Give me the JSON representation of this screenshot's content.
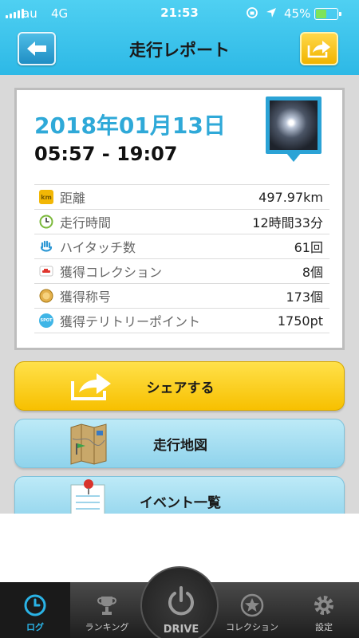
{
  "status_bar": {
    "carrier": "au",
    "network": "4G",
    "time": "21:53",
    "battery_percent": "45%",
    "battery_level": 0.45
  },
  "header": {
    "title": "走行レポート",
    "back_icon": "arrow-left-icon",
    "share_icon": "share-arrow-icon"
  },
  "report": {
    "date": "2018年01月13日",
    "time_range": "05:57 - 19:07",
    "stats": [
      {
        "icon": "km-icon",
        "icon_text": "km",
        "label": "距離",
        "value": "497.97km"
      },
      {
        "icon": "clock-icon",
        "label": "走行時間",
        "value": "12時間33分"
      },
      {
        "icon": "hand-icon",
        "label": "ハイタッチ数",
        "value": "61回"
      },
      {
        "icon": "car-card-icon",
        "label": "獲得コレクション",
        "value": "8個"
      },
      {
        "icon": "medal-icon",
        "label": "獲得称号",
        "value": "173個"
      },
      {
        "icon": "spot-icon",
        "icon_text": "SPOT",
        "label": "獲得テリトリーポイント",
        "value": "1750pt"
      }
    ]
  },
  "actions": {
    "share": "シェアする",
    "map": "走行地図",
    "events": "イベント一覧"
  },
  "tabbar": {
    "log": "ログ",
    "ranking": "ランキング",
    "drive": "DRIVE",
    "collection": "コレクション",
    "settings": "設定"
  },
  "colors": {
    "header": "#2ab3e6",
    "accent_blue": "#2fa9d8",
    "share_yellow": "#f7c000"
  }
}
